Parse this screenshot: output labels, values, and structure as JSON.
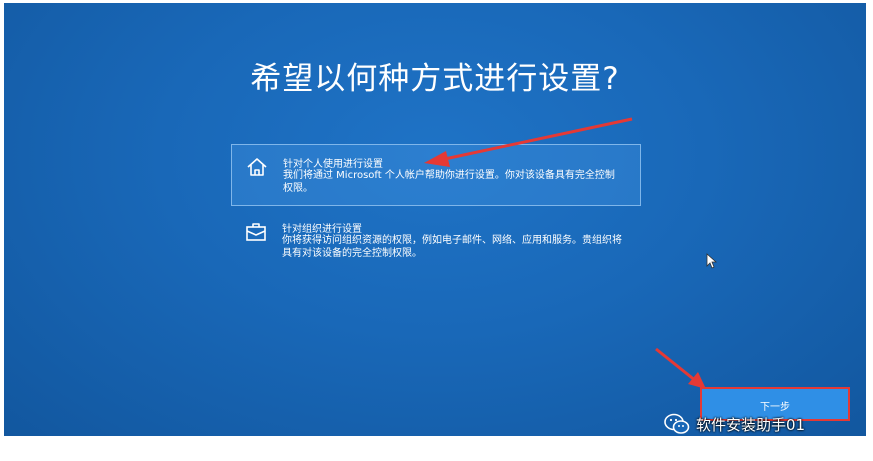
{
  "page": {
    "title": "希望以何种方式进行设置?"
  },
  "options": [
    {
      "title": "针对个人使用进行设置",
      "description": "我们将通过 Microsoft 个人帐户帮助你进行设置。你对该设备具有完全控制权限。",
      "icon": "home-icon",
      "selected": true
    },
    {
      "title": "针对组织进行设置",
      "description": "你将获得访问组织资源的权限，例如电子邮件、网络、应用和服务。贵组织将具有对该设备的完全控制权限。",
      "icon": "briefcase-icon",
      "selected": false
    }
  ],
  "next_button": {
    "label": "下一步"
  },
  "watermark": {
    "text": "软件安装助手01",
    "icon": "wechat-icon"
  },
  "colors": {
    "screen_blue": "#1968b8",
    "selected_border": "#7fb6ea",
    "annotation_red": "#e53935",
    "button_blue": "#2f8fe6"
  }
}
